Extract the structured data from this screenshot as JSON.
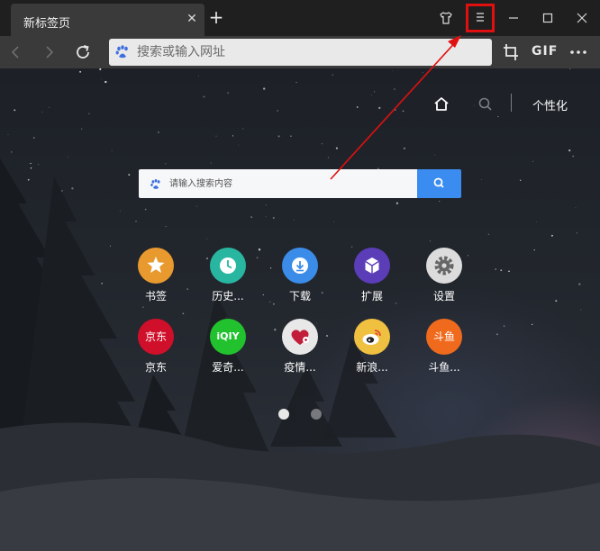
{
  "tab": {
    "title": "新标签页",
    "close_icon": "close-icon"
  },
  "new_tab_icon": "plus-icon",
  "window_controls": [
    "skin-icon",
    "menu-icon",
    "minimize-icon",
    "maximize-icon",
    "close-icon"
  ],
  "toolbar": {
    "address_placeholder": "搜索或输入网址",
    "gif_label": "GIF"
  },
  "content": {
    "personalize_label": "个性化",
    "search_placeholder": "请输入搜索内容"
  },
  "shortcuts": [
    {
      "label": "书签",
      "icon": "star-icon",
      "color": "#e99a2e"
    },
    {
      "label": "历史...",
      "icon": "clock-icon",
      "color": "#29b6a0"
    },
    {
      "label": "下载",
      "icon": "download-icon",
      "color": "#3b8ce8"
    },
    {
      "label": "扩展",
      "icon": "extension-icon",
      "color": "#5b3db8"
    },
    {
      "label": "设置",
      "icon": "gear-icon",
      "color": "#dcdcdc"
    },
    {
      "label": "京东",
      "logo": "京东",
      "color": "#d0102a"
    },
    {
      "label": "爱奇...",
      "logo": "iQIY",
      "color": "#22c22f"
    },
    {
      "label": "疫情...",
      "icon": "heart-icon",
      "color": "#e8e8e8"
    },
    {
      "label": "新浪...",
      "icon": "weibo-icon",
      "color": "#f0c040"
    },
    {
      "label": "斗鱼...",
      "logo": "斗鱼",
      "color": "#f06a1e"
    }
  ],
  "pagination": {
    "pages": 2,
    "active": 1
  },
  "annotation": {
    "color": "#e01010"
  }
}
